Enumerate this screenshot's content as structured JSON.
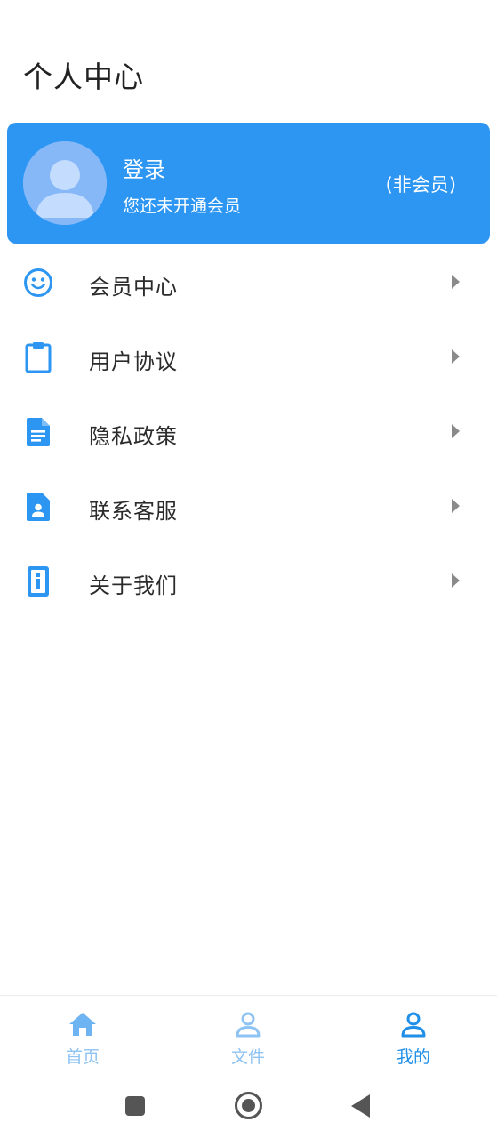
{
  "header": {
    "title": "个人中心"
  },
  "profile": {
    "login_label": "登录",
    "membership_status": "您还未开通会员",
    "member_badge": "(非会员)"
  },
  "menu": {
    "items": [
      {
        "label": "会员中心",
        "icon": "smiley-icon"
      },
      {
        "label": "用户协议",
        "icon": "clipboard-icon"
      },
      {
        "label": "隐私政策",
        "icon": "document-icon"
      },
      {
        "label": "联系客服",
        "icon": "contact-card-icon"
      },
      {
        "label": "关于我们",
        "icon": "info-icon"
      }
    ]
  },
  "bottom_nav": {
    "tabs": [
      {
        "label": "首页",
        "icon": "home-icon",
        "active": false
      },
      {
        "label": "文件",
        "icon": "person-icon",
        "active": false
      },
      {
        "label": "我的",
        "icon": "person-icon",
        "active": true
      }
    ]
  },
  "colors": {
    "accent": "#2d96f2",
    "active_tab": "#1f8fe8",
    "inactive_tab": "#8ec3f3",
    "menu_icon": "#2d96f2"
  }
}
